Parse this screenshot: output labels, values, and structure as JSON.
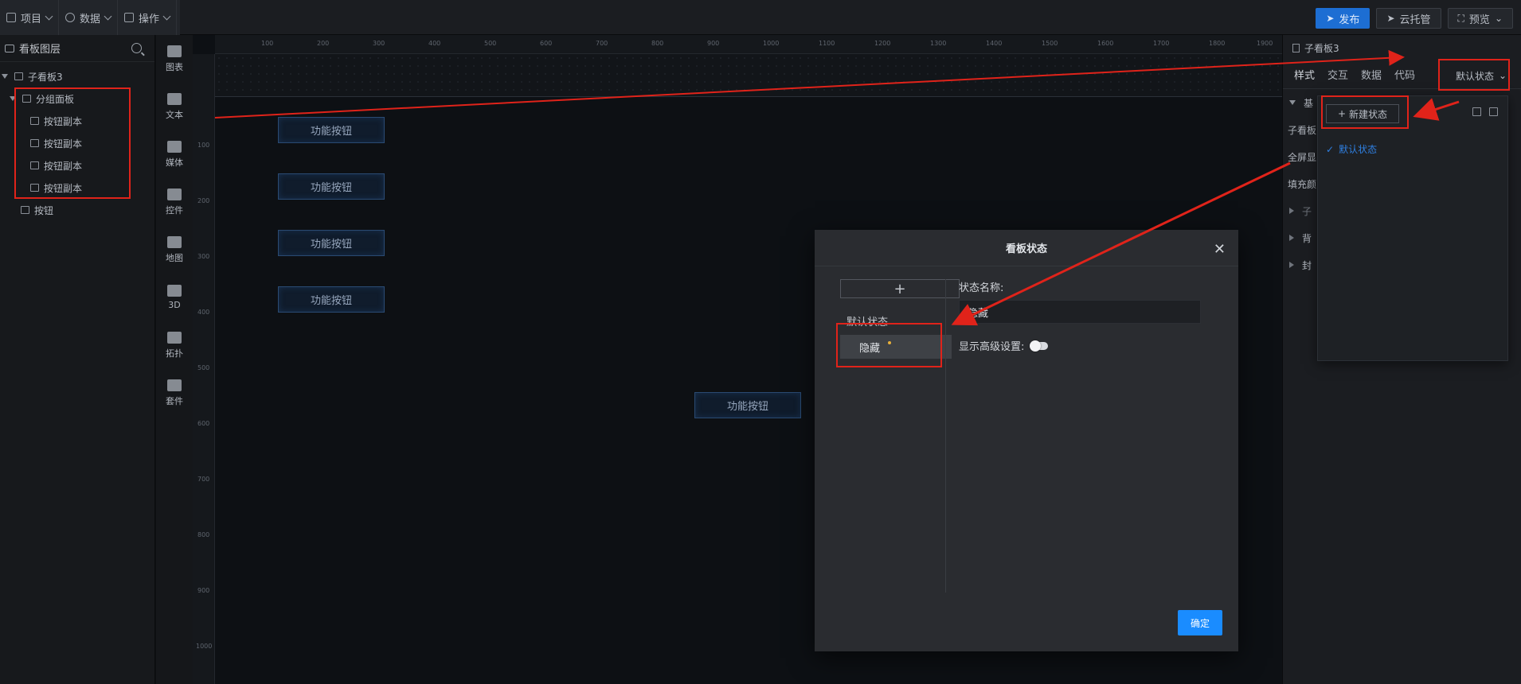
{
  "menu": {
    "project": "项目",
    "data": "数据",
    "operation": "操作"
  },
  "top_actions": {
    "publish": "发布",
    "cloud": "云托管",
    "preview": "预览"
  },
  "layers": {
    "title": "看板图层",
    "root": "子看板3",
    "group": "分组面板",
    "children": [
      "按钮副本",
      "按钮副本",
      "按钮副本",
      "按钮副本"
    ],
    "button": "按钮"
  },
  "rail": [
    "图表",
    "文本",
    "媒体",
    "控件",
    "地图",
    "3D",
    "拓扑",
    "套件"
  ],
  "ruler_h": [
    "100",
    "200",
    "300",
    "400",
    "500",
    "600",
    "700",
    "800",
    "900",
    "1000",
    "1100",
    "1200",
    "1300",
    "1400",
    "1500",
    "1600",
    "1700",
    "1800",
    "1900"
  ],
  "ruler_v": [
    "100",
    "200",
    "300",
    "400",
    "500",
    "600",
    "700",
    "800",
    "900",
    "1000"
  ],
  "canvas_buttons": [
    "功能按钮",
    "功能按钮",
    "功能按钮",
    "功能按钮",
    "功能按钮"
  ],
  "props": {
    "title": "子看板3",
    "tabs": [
      "样式",
      "交互",
      "数据",
      "代码"
    ],
    "state_select": "默认状态",
    "rows": [
      "基",
      "子看板",
      "全屏显",
      "填充颜",
      "子",
      "背",
      "封"
    ]
  },
  "state_dropdown": {
    "new_state": "新建状态",
    "selected": "默认状态"
  },
  "dialog": {
    "title": "看板状态",
    "add": "+",
    "states": [
      "默认状态",
      "隐藏"
    ],
    "name_label": "状态名称:",
    "name_value": "隐藏",
    "advanced_label": "显示高级设置:",
    "ok": "确定"
  },
  "colors": {
    "accent": "#1a8cff",
    "annotation": "#e0231a",
    "publish": "#1d6ed3"
  }
}
